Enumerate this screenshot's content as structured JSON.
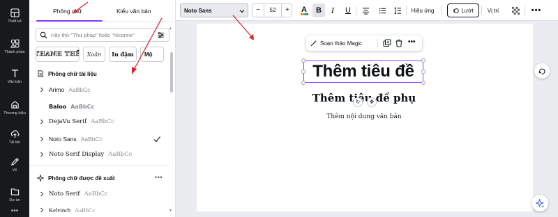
{
  "rail": {
    "items": [
      {
        "label": "Thiết kế",
        "icon": "layout-icon"
      },
      {
        "label": "Thành phần",
        "icon": "elements-icon"
      },
      {
        "label": "Văn bản",
        "icon": "text-icon"
      },
      {
        "label": "Thương hiệu",
        "icon": "brand-icon"
      },
      {
        "label": "Tải lên",
        "icon": "upload-icon"
      },
      {
        "label": "Vẽ",
        "icon": "draw-icon"
      },
      {
        "label": "Dự án",
        "icon": "folder-icon"
      }
    ],
    "more": "•••"
  },
  "panel": {
    "tabs": [
      "Phông chữ",
      "Kiểu văn bản"
    ],
    "search_placeholder": "Hãy thử \"Thư pháp\" hoặc \"Niconne\"",
    "chips": [
      "THANH THẾ",
      "Xoăn",
      "In đậm",
      "Mộ"
    ],
    "section_docs": {
      "title": "Phông chữ tài liệu"
    },
    "doc_fonts": [
      {
        "name": "Arimo",
        "sample": "AaBbCc"
      },
      {
        "name": "Baloo",
        "sample": "AaBbCc"
      },
      {
        "name": "DejaVu Serif",
        "sample": "AaBbCc"
      },
      {
        "name": "Noto Sans",
        "sample": "AaBbCc"
      },
      {
        "name": "Noto Serif Display",
        "sample": "AaBbCc"
      }
    ],
    "section_suggested": {
      "title": "Phông chữ được đề xuất",
      "more": "•••"
    },
    "suggested_fonts": [
      {
        "name": "Noto Serif",
        "sample": "AaBbCc"
      },
      {
        "name": "Kelvinch",
        "sample": "AaBbCc"
      }
    ]
  },
  "toolbar": {
    "font": "Noto Sans",
    "size": "52",
    "minus": "−",
    "plus": "+",
    "color_letter": "A",
    "bold": "B",
    "italic": "I",
    "underline": "U",
    "effects": "Hiệu ứng",
    "animate": "Lướt",
    "position": "Vị trí",
    "more": "•••"
  },
  "canvas": {
    "magic_edit": "Soạn thảo Magic",
    "magic_more": "•••",
    "title": "Thêm tiêu đề",
    "subtitle": "Thêm tiêu đề phụ",
    "body": "Thêm nội dung văn bản"
  },
  "colors": {
    "accent": "#8b3dff",
    "rail_bg": "#18191b",
    "annotation_arrow": "#d62828"
  }
}
